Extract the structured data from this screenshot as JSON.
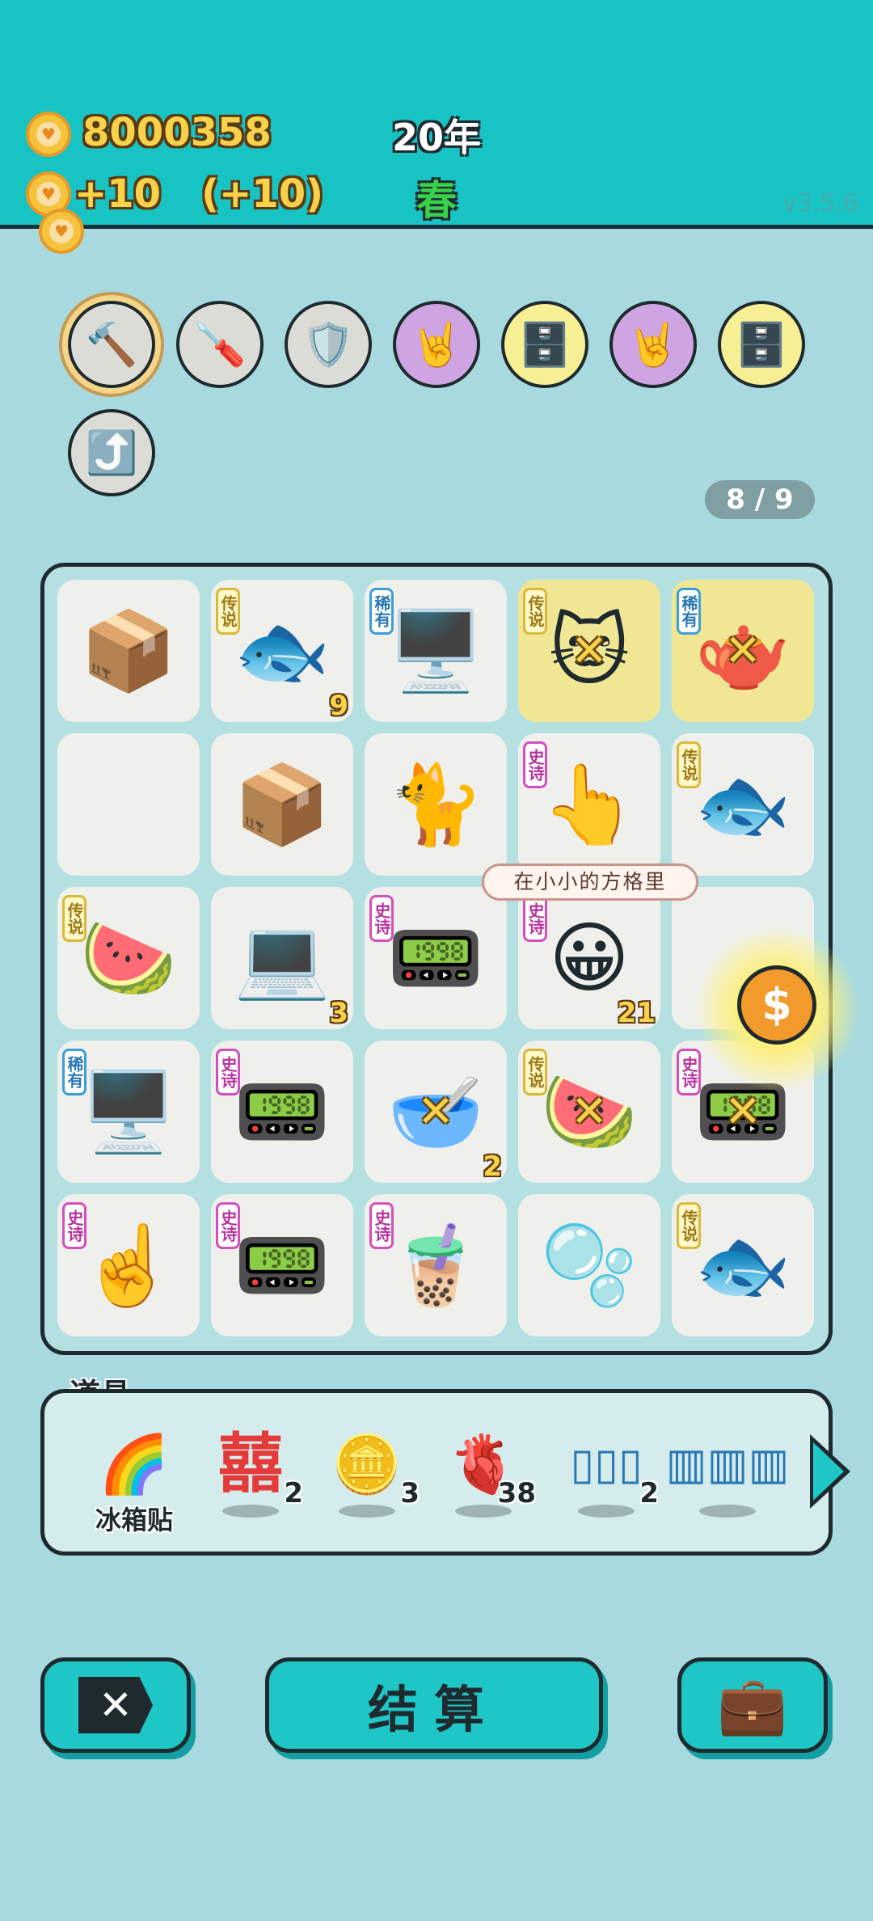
{
  "header": {
    "money": "8000358",
    "income": "+10   (+10)",
    "year": "20年",
    "season": "春",
    "version": "v3.5.6"
  },
  "tools": [
    {
      "name": "hammer",
      "icon": "🔨",
      "style": "gold"
    },
    {
      "name": "screwdriver",
      "icon": "🪛",
      "style": "grey"
    },
    {
      "name": "wrench-shield",
      "icon": "🛡️",
      "style": "grey"
    },
    {
      "name": "rock-hand",
      "icon": "🤘",
      "style": "purple"
    },
    {
      "name": "safe",
      "icon": "🗄️",
      "style": "yellow"
    },
    {
      "name": "rock-hand",
      "icon": "🤘",
      "style": "purple"
    },
    {
      "name": "safe",
      "icon": "🗄️",
      "style": "yellow"
    },
    {
      "name": "upgrade-arrow",
      "icon": "⤴️",
      "style": "grey"
    }
  ],
  "page_count": "8 / 9",
  "board": [
    {
      "icon": "📦",
      "tag": "",
      "num": ""
    },
    {
      "icon": "🐟",
      "tag": "传说",
      "tag_type": "legend",
      "num": "9"
    },
    {
      "icon": "🖥️",
      "tag": "稀有",
      "tag_type": "rare",
      "num": ""
    },
    {
      "icon": "🐱",
      "tag": "传说",
      "tag_type": "legend",
      "num": "",
      "x": true,
      "hl": true
    },
    {
      "icon": "🫖",
      "tag": "稀有",
      "tag_type": "rare",
      "num": "",
      "x": true,
      "hl": true
    },
    {
      "icon": "",
      "tag": "",
      "num": ""
    },
    {
      "icon": "📦",
      "tag": "",
      "num": ""
    },
    {
      "icon": "🐈",
      "tag": "",
      "num": ""
    },
    {
      "icon": "👆",
      "tag": "史诗",
      "tag_type": "epic",
      "num": ""
    },
    {
      "icon": "🐟",
      "tag": "传说",
      "tag_type": "legend",
      "num": ""
    },
    {
      "icon": "🍉",
      "tag": "传说",
      "tag_type": "legend",
      "num": ""
    },
    {
      "icon": "💻",
      "tag": "",
      "num": "3"
    },
    {
      "icon": "📟",
      "tag": "史诗",
      "tag_type": "epic",
      "num": ""
    },
    {
      "icon": "😀",
      "tag": "史诗",
      "tag_type": "epic",
      "num": "21"
    },
    {
      "icon": "",
      "tag": "",
      "num": ""
    },
    {
      "icon": "🖥️",
      "tag": "稀有",
      "tag_type": "rare",
      "num": ""
    },
    {
      "icon": "📟",
      "tag": "史诗",
      "tag_type": "epic",
      "num": ""
    },
    {
      "icon": "🥣",
      "tag": "",
      "num": "2",
      "x": true
    },
    {
      "icon": "🍉",
      "tag": "传说",
      "tag_type": "legend",
      "num": "",
      "x": true
    },
    {
      "icon": "📟",
      "tag": "史诗",
      "tag_type": "epic",
      "num": "",
      "x": true
    },
    {
      "icon": "☝️",
      "tag": "史诗",
      "tag_type": "epic",
      "num": ""
    },
    {
      "icon": "📟",
      "tag": "史诗",
      "tag_type": "epic",
      "num": ""
    },
    {
      "icon": "🧋",
      "tag": "史诗",
      "tag_type": "epic",
      "num": ""
    },
    {
      "icon": "🫧",
      "tag": "",
      "num": ""
    },
    {
      "icon": "🐟",
      "tag": "传说",
      "tag_type": "legend",
      "num": ""
    }
  ],
  "speech_bubble": "在小小的方格里",
  "big_coin": "$",
  "items": {
    "title": "道具",
    "list": [
      {
        "name": "rainbow",
        "icon": "🌈",
        "label": "冰箱贴",
        "qty": ""
      },
      {
        "name": "double-happiness",
        "icon": "囍",
        "label": "",
        "qty": "2"
      },
      {
        "name": "coin",
        "icon": "🪙",
        "label": "",
        "qty": "3"
      },
      {
        "name": "liver",
        "icon": "🫀",
        "label": "",
        "qty": "38"
      },
      {
        "name": "slots",
        "icon": "▯▯▯",
        "label": "",
        "qty": "2"
      },
      {
        "name": "rare-slots",
        "icon": "▥▥▥",
        "label": "",
        "qty": ""
      }
    ]
  },
  "buttons": {
    "close": "✕",
    "settle": "结算",
    "bag": "💼"
  }
}
